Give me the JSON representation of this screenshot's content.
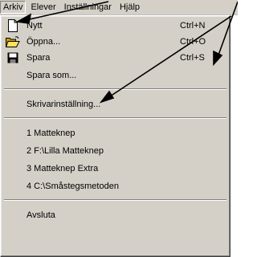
{
  "menubar": {
    "items": [
      {
        "label": "Arkiv"
      },
      {
        "label": "Elever"
      },
      {
        "label": "Inställningar"
      },
      {
        "label": "Hjälp"
      }
    ]
  },
  "file_menu": {
    "nytt": {
      "label": "Nytt",
      "shortcut": "Ctrl+N",
      "icon": "new-document-icon"
    },
    "oppna": {
      "label": "Öppna...",
      "shortcut": "Ctrl+O",
      "icon": "open-folder-icon"
    },
    "spara": {
      "label": "Spara",
      "shortcut": "Ctrl+S",
      "icon": "floppy-disk-icon"
    },
    "spara_som": {
      "label": "Spara som..."
    },
    "skrivar": {
      "label": "Skrivarinställning..."
    },
    "recent": [
      {
        "label": "1 Matteknep"
      },
      {
        "label": "2 F:\\Lilla Matteknep"
      },
      {
        "label": "3 Matteknep Extra"
      },
      {
        "label": "4 C:\\Småstegsmetoden"
      }
    ],
    "avsluta": {
      "label": "Avsluta"
    }
  },
  "colors": {
    "menu_bg": "#d4d0c8",
    "arrow": "#000000"
  }
}
